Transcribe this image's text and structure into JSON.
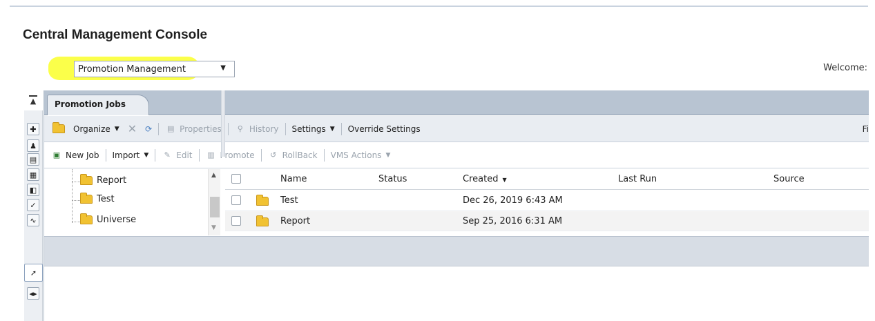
{
  "app": {
    "title": "Central Management Console",
    "selector_value": "Promotion Management",
    "welcome": "Welcome:"
  },
  "tabs": [
    {
      "label": "Promotion Jobs"
    }
  ],
  "toolbar1": {
    "organize": "Organize",
    "properties": "Properties",
    "history": "History",
    "settings": "Settings",
    "override_settings": "Override Settings",
    "right_truncated": "Fi"
  },
  "toolbar2": {
    "new_job": "New Job",
    "import": "Import",
    "edit": "Edit",
    "promote": "Promote",
    "rollback": "RollBack",
    "vms_actions": "VMS Actions"
  },
  "tree": {
    "items": [
      {
        "label": "Report"
      },
      {
        "label": "Test"
      },
      {
        "label": "Universe"
      }
    ]
  },
  "grid": {
    "columns": [
      "Name",
      "Status",
      "Created",
      "Last Run",
      "Source"
    ],
    "rows": [
      {
        "name": "Test",
        "status": "",
        "created": "Dec 26, 2019 6:43 AM",
        "last_run": "",
        "source": ""
      },
      {
        "name": "Report",
        "status": "",
        "created": "Sep 25, 2016 6:31 AM",
        "last_run": "",
        "source": ""
      }
    ]
  },
  "colors": {
    "highlight": "#fbff4a",
    "tabbar": "#b8c4d2",
    "toolbar": "#e9edf2"
  }
}
